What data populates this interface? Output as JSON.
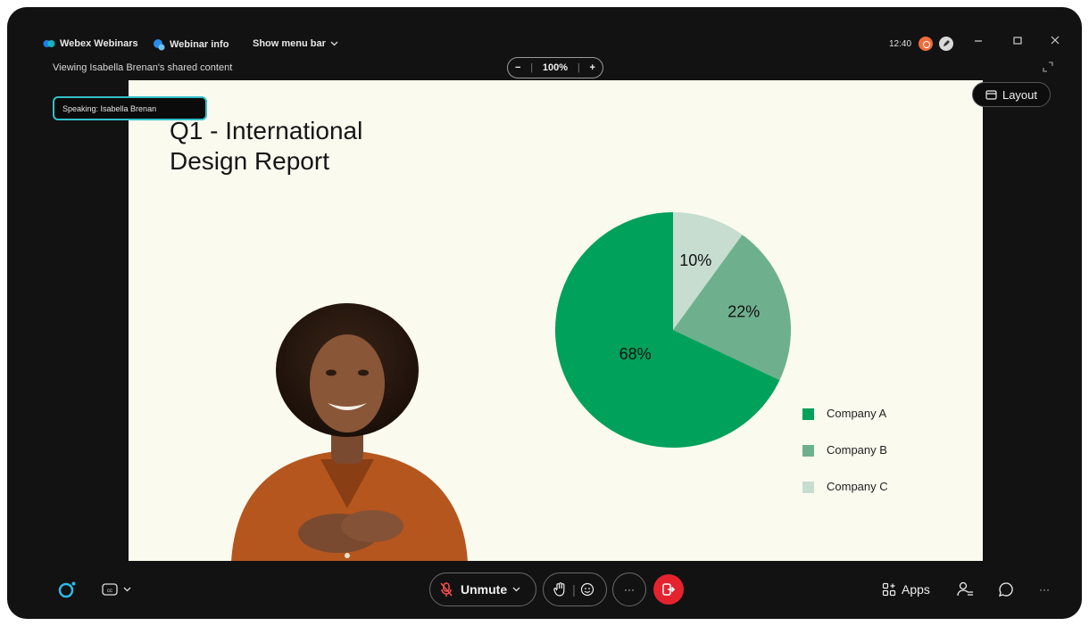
{
  "titlebar": {
    "app_name": "Webex Webinars",
    "webinar_info": "Webinar info",
    "show_menu_bar": "Show menu bar",
    "viewing_label": "Viewing Isabella Brenan's shared content",
    "zoom_minus": "−",
    "zoom_level": "100%",
    "zoom_plus": "+",
    "clock": "12:40"
  },
  "speaking_label": "Speaking: Isabella Brenan",
  "layout_label": "Layout",
  "slide": {
    "title_line1": "Q1 -  International",
    "title_line2": "Design Report"
  },
  "chart_data": {
    "type": "pie",
    "categories": [
      "Company A",
      "Company B",
      "Company C"
    ],
    "values": [
      68,
      22,
      10
    ],
    "labels": [
      "68%",
      "22%",
      "10%"
    ],
    "colors": [
      "#00a15b",
      "#6eb08e",
      "#c6ddd0"
    ],
    "legend_position": "bottom-right"
  },
  "toolbar": {
    "unmute_label": "Unmute",
    "more_label": "···",
    "apps_label": "Apps",
    "overflow_label": "···"
  },
  "colors": {
    "accent_teal": "#33c0c8",
    "leave_red": "#e5232f",
    "recording_orange": "#f26b3a"
  }
}
